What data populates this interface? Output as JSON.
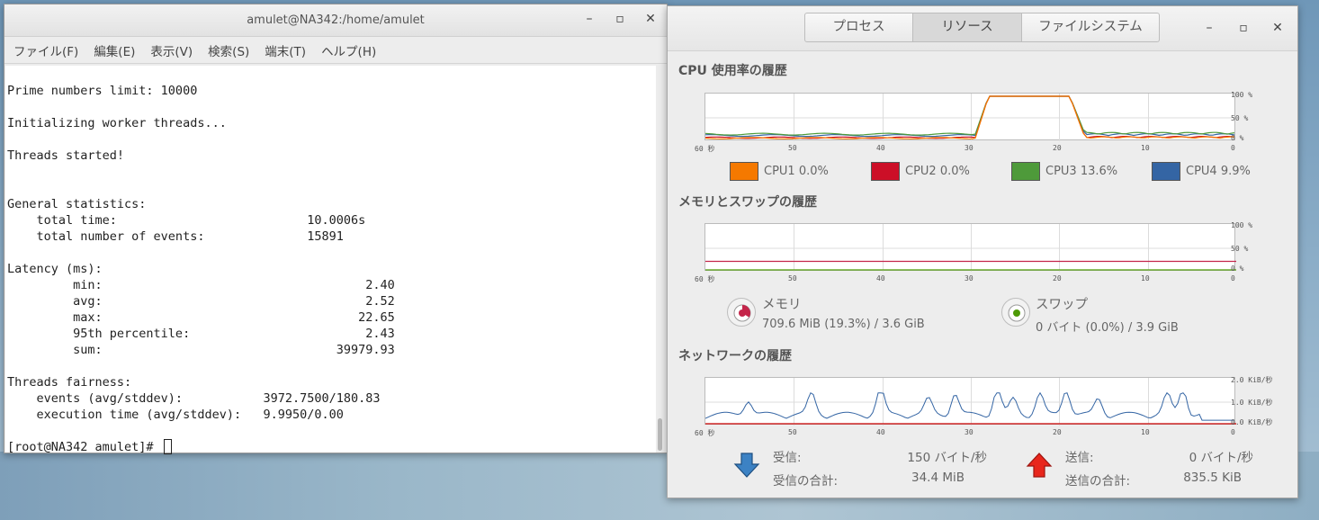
{
  "terminal": {
    "title": "amulet@NA342:/home/amulet",
    "menu": [
      "ファイル(F)",
      "編集(E)",
      "表示(V)",
      "検索(S)",
      "端末(T)",
      "ヘルプ(H)"
    ],
    "lines": [
      "Prime numbers limit: 10000",
      "",
      "Initializing worker threads...",
      "",
      "Threads started!",
      "",
      "",
      "General statistics:",
      "    total time:                          10.0006s",
      "    total number of events:              15891",
      "",
      "Latency (ms):",
      "         min:                                    2.40",
      "         avg:                                    2.52",
      "         max:                                   22.65",
      "         95th percentile:                        2.43",
      "         sum:                                39979.93",
      "",
      "Threads fairness:",
      "    events (avg/stddev):           3972.7500/180.83",
      "    execution time (avg/stddev):   9.9950/0.00",
      "",
      "[root@NA342 amulet]# "
    ]
  },
  "monitor": {
    "tabs": [
      "プロセス",
      "リソース",
      "ファイルシステム"
    ],
    "active_tab": "リソース",
    "cpu": {
      "title": "CPU 使用率の履歴",
      "legend": [
        {
          "label": "CPU1 0.0%",
          "color": "#f57900"
        },
        {
          "label": "CPU2 0.0%",
          "color": "#cc0f27"
        },
        {
          "label": "CPU3 13.6%",
          "color": "#4e9a3a"
        },
        {
          "label": "CPU4 9.9%",
          "color": "#3465a4"
        }
      ]
    },
    "memory": {
      "title": "メモリとスワップの履歴",
      "mem_label": "メモリ",
      "mem_value": "709.6 MiB (19.3%) / 3.6 GiB",
      "swap_label": "スワップ",
      "swap_value": "0 バイト (0.0%) / 3.9 GiB",
      "mem_color": "#c4254a",
      "swap_color": "#4e9a06"
    },
    "network": {
      "title": "ネットワークの履歴",
      "recv_label": "受信:",
      "recv_rate": "150 バイト/秒",
      "recv_total_label": "受信の合計:",
      "recv_total": "34.4 MiB",
      "send_label": "送信:",
      "send_rate": "0 バイト/秒",
      "send_total_label": "送信の合計:",
      "send_total": "835.5 KiB"
    },
    "x_ticks": [
      "60 秒",
      "50",
      "40",
      "30",
      "20",
      "10",
      "0"
    ],
    "pct_ticks": [
      "100 %",
      "50 %",
      "0 %"
    ],
    "net_ticks": [
      "2.0 KiB/秒",
      "1.0 KiB/秒",
      "0.0 KiB/秒"
    ]
  }
}
